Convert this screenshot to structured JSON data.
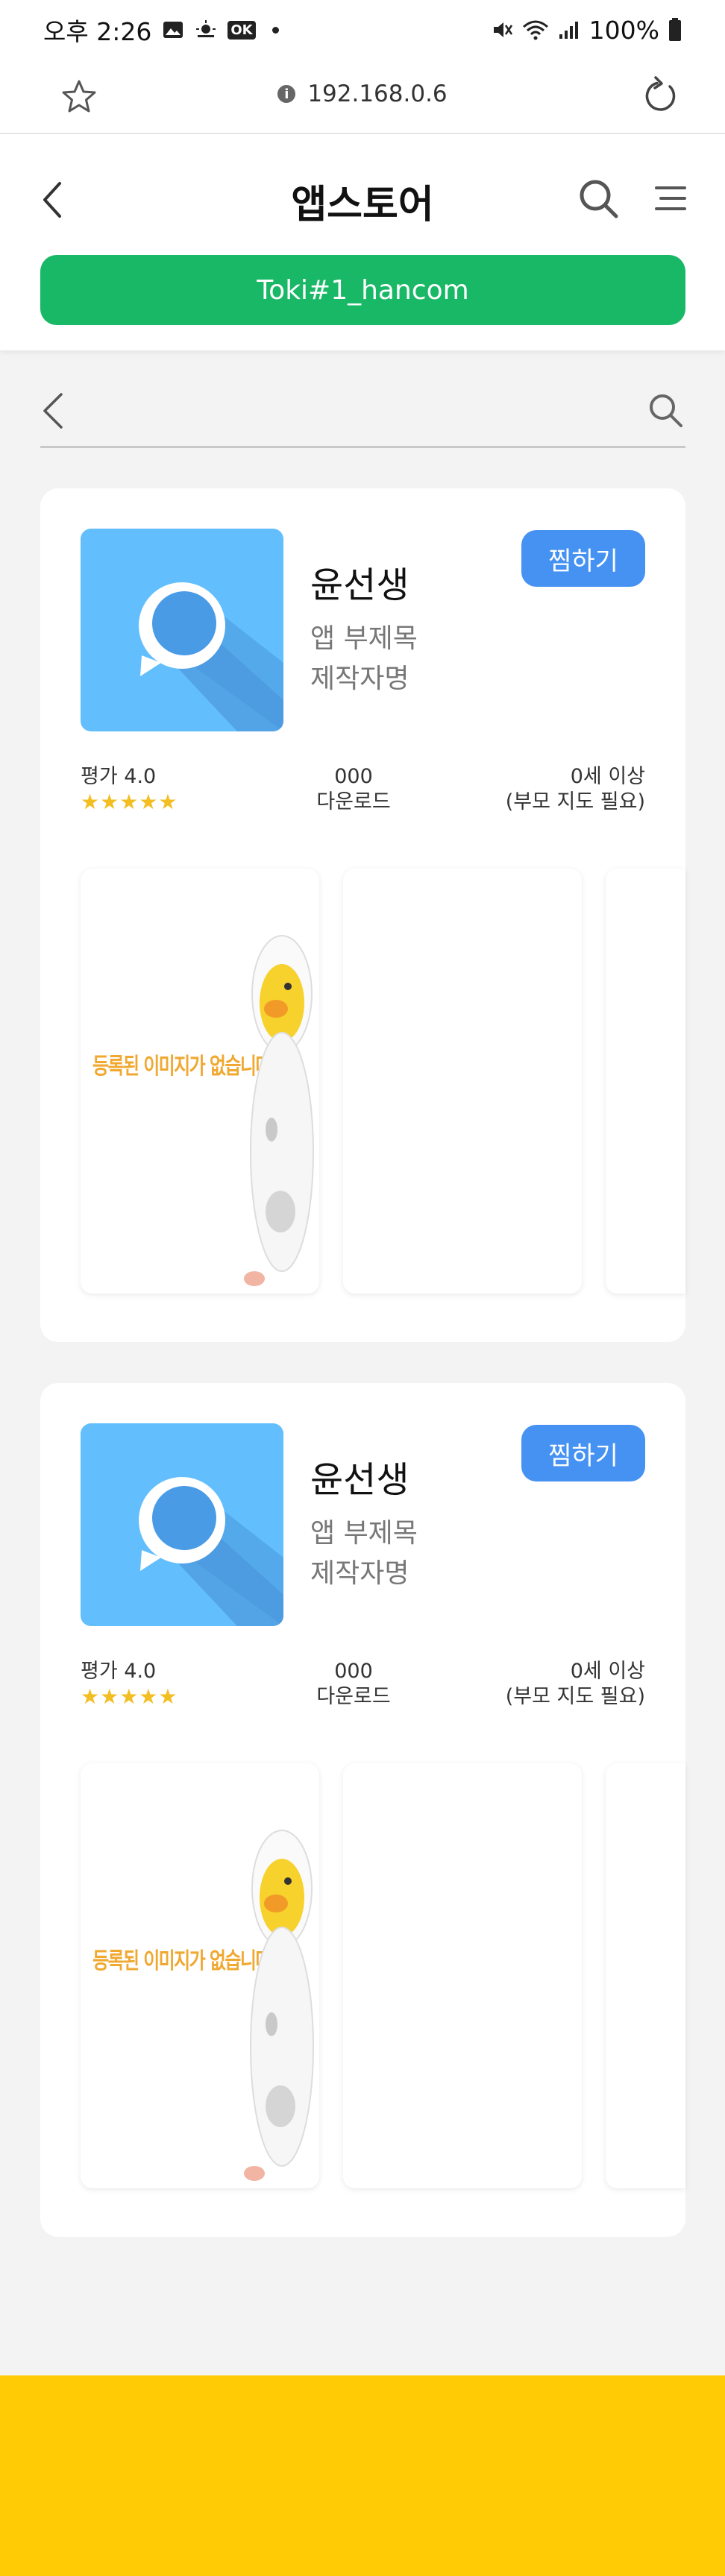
{
  "status_bar": {
    "time": "오후 2:26",
    "ok_badge": "OK",
    "battery": "100%"
  },
  "browser": {
    "url": "192.168.0.6",
    "info_glyph": "i"
  },
  "header": {
    "title": "앱스토어",
    "user_button": "Toki#1_hancom"
  },
  "cards": [
    {
      "app_name": "윤선생",
      "subtitle": "앱 부제목",
      "maker": "제작자명",
      "wish_label": "찜하기",
      "rating_label": "평가 4.0",
      "stars": "★★★★★",
      "rating": 4.0,
      "downloads": "000",
      "downloads_label": "다운로드",
      "age": "0세 이상",
      "age_note": "(부모 지도 필요)",
      "no_image_text": "등록된 이미지가 없습니다"
    },
    {
      "app_name": "윤선생",
      "subtitle": "앱 부제목",
      "maker": "제작자명",
      "wish_label": "찜하기",
      "rating_label": "평가 4.0",
      "stars": "★★★★★",
      "rating": 4.0,
      "downloads": "000",
      "downloads_label": "다운로드",
      "age": "0세 이상",
      "age_note": "(부모 지도 필요)",
      "no_image_text": "등록된 이미지가 없습니다"
    }
  ],
  "colors": {
    "accent_green": "#19b866",
    "wish_blue": "#4592f3",
    "app_icon_bg": "#62befc",
    "star_yellow": "#f2be22",
    "bottom_bar": "#ffcb05"
  }
}
